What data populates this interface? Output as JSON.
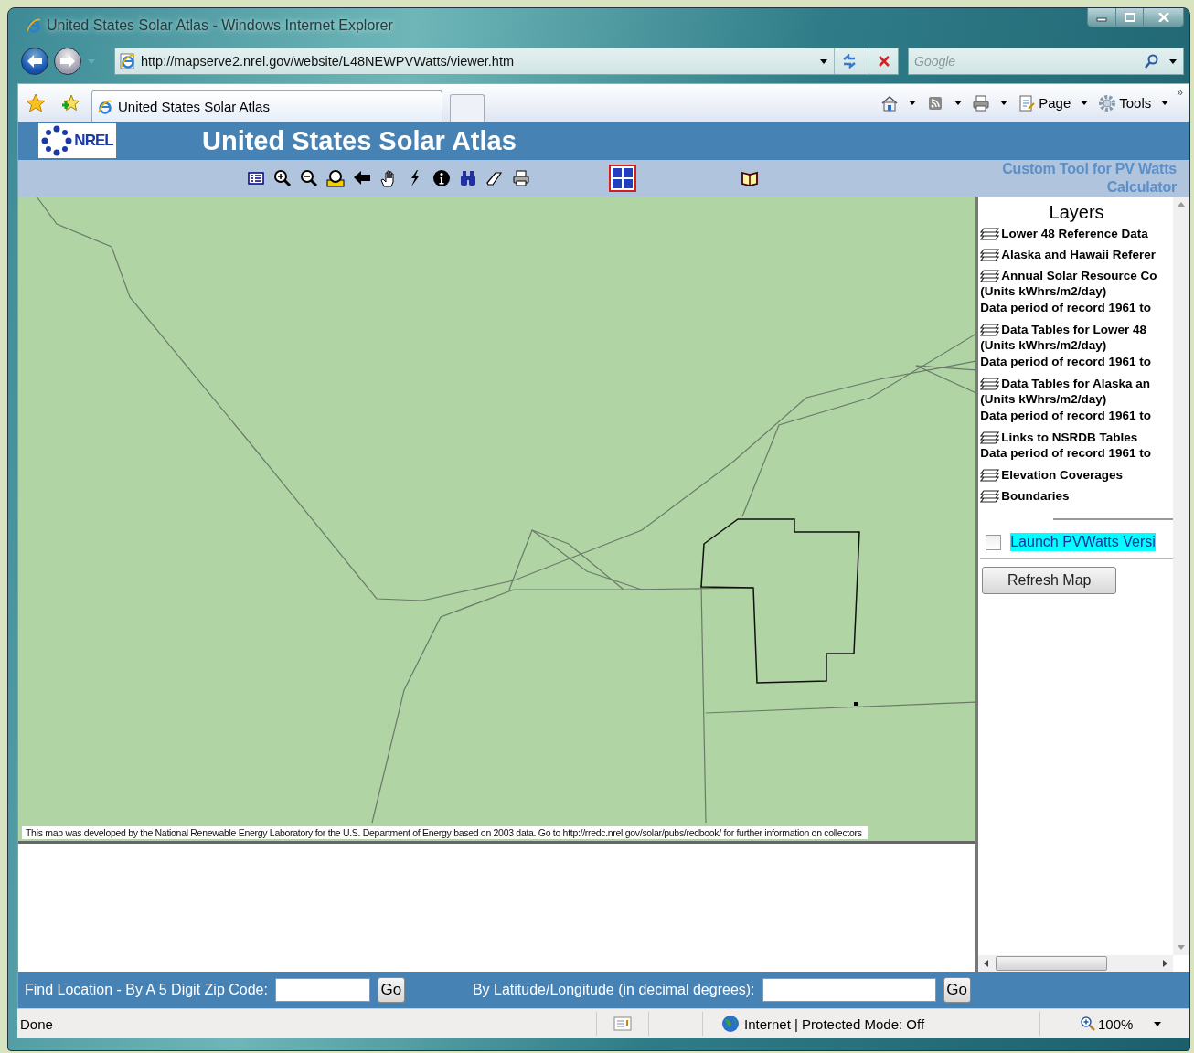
{
  "window": {
    "title": "United States Solar Atlas - Windows Internet Explorer"
  },
  "address_bar": {
    "url": "http://mapserve2.nrel.gov/website/L48NEWPVWatts/viewer.htm",
    "search": {
      "placeholder": "Google"
    }
  },
  "favorites_bar": {
    "tabs": [
      {
        "label": "United States Solar Atlas",
        "selected": true
      }
    ],
    "commands": [
      {
        "kind": "home"
      },
      {
        "kind": "feeds"
      },
      {
        "kind": "print"
      },
      {
        "kind": "page",
        "label": "Page"
      },
      {
        "kind": "tools",
        "label": "Tools"
      }
    ],
    "more": "»"
  },
  "page": {
    "logo": "NREL",
    "title": "United States Solar Atlas",
    "tools": [
      {
        "kind": "legend"
      },
      {
        "kind": "zoom-in"
      },
      {
        "kind": "zoom-out"
      },
      {
        "kind": "full-extent"
      },
      {
        "kind": "back"
      },
      {
        "kind": "pan"
      },
      {
        "kind": "identify"
      },
      {
        "kind": "info"
      },
      {
        "kind": "find"
      },
      {
        "kind": "clear"
      },
      {
        "kind": "print"
      }
    ],
    "extra_tools": [
      {
        "kind": "pvwatts"
      },
      {
        "kind": "book"
      }
    ],
    "custom_tool_link": "Custom Tool for PV Watts Calculator",
    "map_credit": "This map was developed by the National Renewable Energy Laboratory for the U.S. Department of Energy based on 2003 data.  Go to http://rredc.nrel.gov/solar/pubs/redbook/ for further information on collectors",
    "layers_title": "Layers",
    "layers": [
      {
        "name": "Lower 48 Reference Data"
      },
      {
        "name": "Alaska and Hawaii Referer"
      },
      {
        "name": "Annual Solar Resource Co",
        "notes": [
          "(Units kWhrs/m2/day)",
          "Data period of record 1961 to"
        ]
      },
      {
        "name": "Data Tables for Lower 48",
        "notes": [
          "(Units kWhrs/m2/day)",
          "Data period of record 1961 to"
        ]
      },
      {
        "name": "Data Tables for Alaska an",
        "notes": [
          "(Units kWhrs/m2/day)",
          "Data period of record 1961 to"
        ]
      },
      {
        "name": "Links to NSRDB Tables",
        "notes": [
          "Data period of record 1961 to"
        ]
      },
      {
        "name": "Elevation Coverages"
      },
      {
        "name": "Boundaries"
      }
    ],
    "launch": {
      "label": "Launch PVWatts Versi",
      "checked": false
    },
    "refresh_button": "Refresh Map",
    "find": {
      "zip_label": "Find Location - By A 5 Digit Zip Code:",
      "zip_go": "Go",
      "latlon_label": "By Latitude/Longitude (in decimal degrees):",
      "latlon_go": "Go"
    }
  },
  "status_bar": {
    "text": "Done",
    "zone": "Internet | Protected Mode: Off",
    "zoom": "100%"
  }
}
